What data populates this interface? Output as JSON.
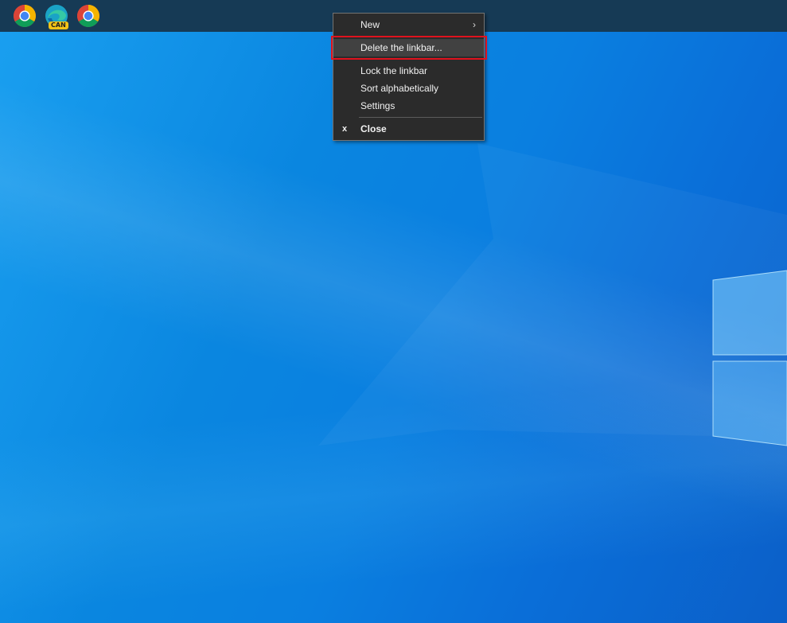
{
  "taskbar": {
    "icons": [
      {
        "name": "chrome-icon",
        "badge": ""
      },
      {
        "name": "edge-canary-icon",
        "badge": "CAN"
      },
      {
        "name": "chrome-icon",
        "badge": ""
      }
    ]
  },
  "menu": {
    "new_label": "New",
    "new_arrow": ">",
    "delete_label": "Delete the linkbar...",
    "lock_label": "Lock the linkbar",
    "sort_label": "Sort alphabetically",
    "settings_label": "Settings",
    "close_glyph": "x",
    "close_label": "Close"
  },
  "colors": {
    "menu_bg": "#2b2b2b",
    "highlight_box": "#e0121d",
    "taskbar_bg": "#163a55",
    "desktop_blue": "#0a86e0"
  }
}
